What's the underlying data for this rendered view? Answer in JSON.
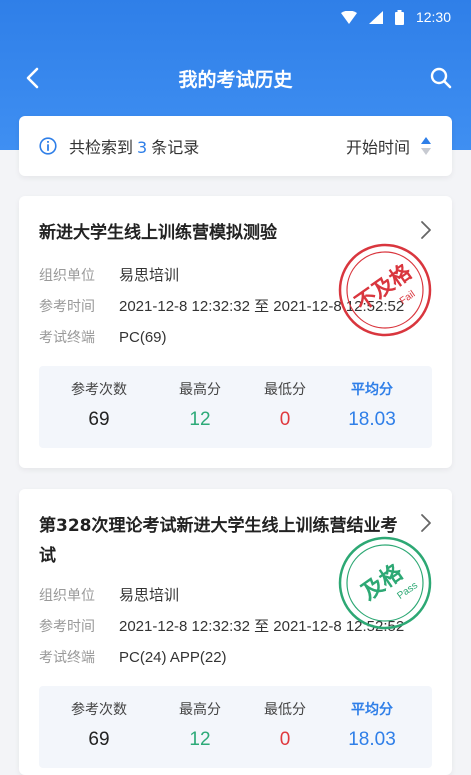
{
  "status_bar": {
    "time": "12:30"
  },
  "nav": {
    "title": "我的考试历史"
  },
  "summary": {
    "prefix": "共检索到",
    "count": "3",
    "suffix": "条记录",
    "sort_label": "开始时间"
  },
  "labels": {
    "org": "组织单位",
    "time": "参考时间",
    "terminal": "考试终端"
  },
  "stat_labels": {
    "attempts": "参考次数",
    "max": "最高分",
    "min": "最低分",
    "avg": "平均分"
  },
  "colors": {
    "brand": "#2f7fe8",
    "max": "#2daa78",
    "min": "#e0393e",
    "avg": "#2f7fe8"
  },
  "records": [
    {
      "title": "新进大学生线上训练营模拟测验",
      "org": "易思培训",
      "time": "2021-12-8 12:32:32 至 2021-12-8 12:52:52",
      "terminal": "PC(69)",
      "stamp": {
        "text": "不及格",
        "sub": "Fail",
        "color": "#d9363e"
      },
      "stats": {
        "attempts": "69",
        "max": "12",
        "min": "0",
        "avg": "18.03"
      }
    },
    {
      "title": "第328次理论考试新进大学生线上训练营结业考试",
      "org": "易思培训",
      "time": "2021-12-8 12:32:32 至 2021-12-8 12:52:52",
      "terminal": "PC(24)  APP(22)",
      "stamp": {
        "text": "及格",
        "sub": "Pass",
        "color": "#2da874"
      },
      "stats": {
        "attempts": "69",
        "max": "12",
        "min": "0",
        "avg": "18.03"
      }
    }
  ]
}
